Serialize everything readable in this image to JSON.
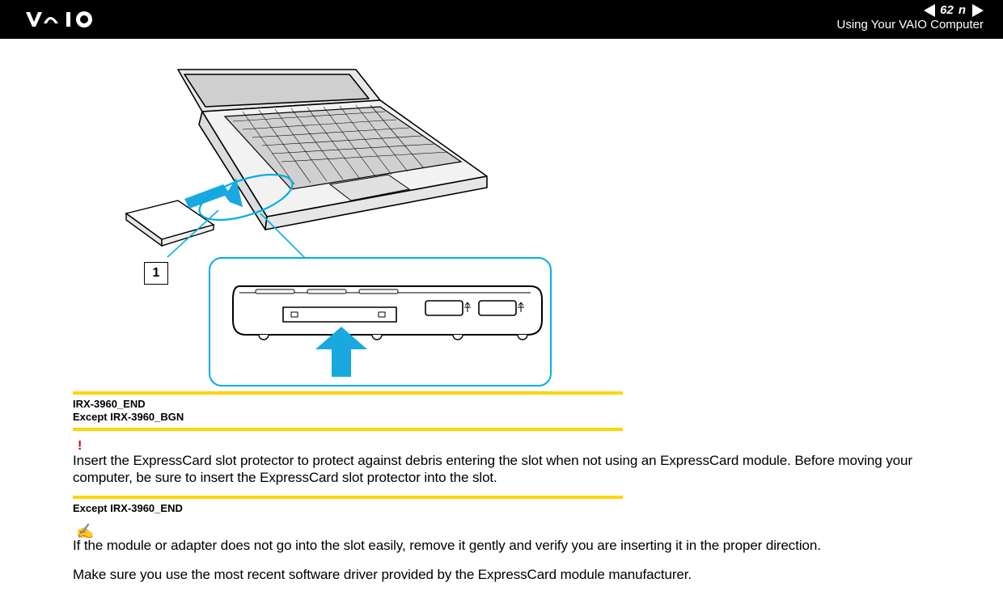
{
  "header": {
    "page_number": "62",
    "section_title": "Using Your VAIO Computer"
  },
  "diagram": {
    "callout_number": "1"
  },
  "codes": {
    "line_a": "IRX-3960_END",
    "line_b": "Except IRX-3960_BGN",
    "line_c": "Except IRX-3960_END"
  },
  "icons": {
    "warning": "!",
    "note": "✍"
  },
  "paragraphs": {
    "warning_text": "Insert the ExpressCard slot protector to protect against debris entering the slot when not using an ExpressCard module. Before moving your computer, be sure to insert the ExpressCard slot protector into the slot.",
    "note_text": "If the module or adapter does not go into the slot easily, remove it gently and verify you are inserting it in the proper direction.",
    "driver_text": "Make sure you use the most recent software driver provided by the ExpressCard module manufacturer."
  }
}
